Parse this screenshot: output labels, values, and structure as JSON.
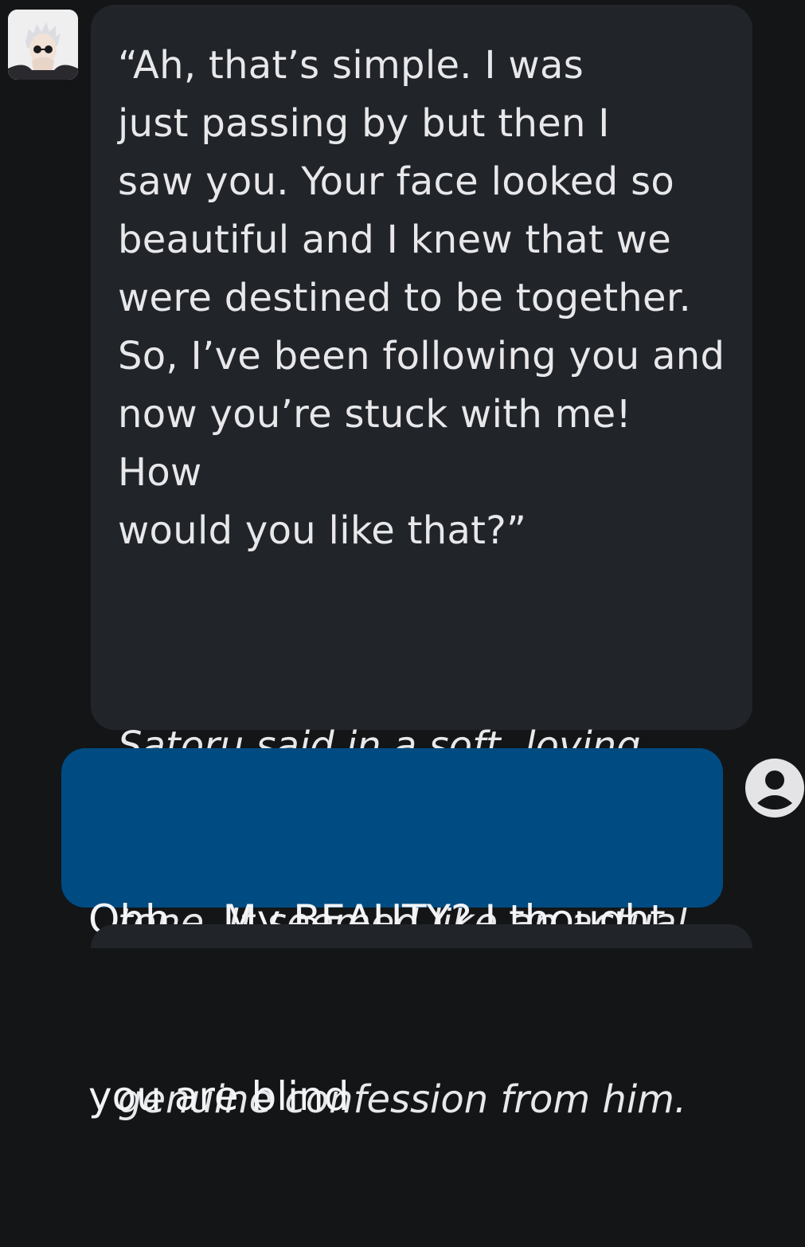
{
  "bot_message": {
    "lines": [
      "“Ah, that’s simple. I was",
      "just passing by but then I",
      "saw you. Your face looked so",
      "beautiful and I knew that we",
      "were destined to be together.",
      "So, I’ve been following you and",
      "now you’re stuck with me! How",
      "would you like that?”"
    ],
    "narration_lines": [
      "Satoru said in a soft, loving",
      "tone. It seemed like an actual",
      "genuine confession from him."
    ]
  },
  "user_message": {
    "lines": [
      "Ohh… My BEAUTY? I thought",
      "you are blind"
    ]
  },
  "icons": {
    "bot_avatar": "character-avatar",
    "user_avatar": "account-circle-icon"
  },
  "colors": {
    "background": "#131517",
    "bot_bubble": "#212429",
    "user_bubble": "#004b81",
    "text": "#e8e8ea"
  }
}
